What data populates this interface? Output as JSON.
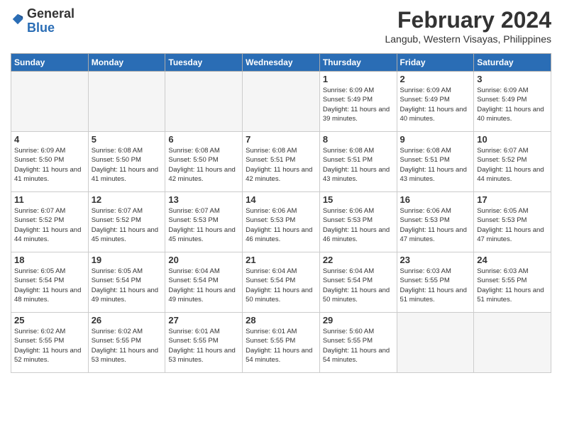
{
  "app": {
    "logo_general": "General",
    "logo_blue": "Blue",
    "title": "February 2024",
    "location": "Langub, Western Visayas, Philippines"
  },
  "calendar": {
    "days_of_week": [
      "Sunday",
      "Monday",
      "Tuesday",
      "Wednesday",
      "Thursday",
      "Friday",
      "Saturday"
    ],
    "weeks": [
      [
        {
          "day": "",
          "info": ""
        },
        {
          "day": "",
          "info": ""
        },
        {
          "day": "",
          "info": ""
        },
        {
          "day": "",
          "info": ""
        },
        {
          "day": "1",
          "info": "Sunrise: 6:09 AM\nSunset: 5:49 PM\nDaylight: 11 hours and 39 minutes."
        },
        {
          "day": "2",
          "info": "Sunrise: 6:09 AM\nSunset: 5:49 PM\nDaylight: 11 hours and 40 minutes."
        },
        {
          "day": "3",
          "info": "Sunrise: 6:09 AM\nSunset: 5:49 PM\nDaylight: 11 hours and 40 minutes."
        }
      ],
      [
        {
          "day": "4",
          "info": "Sunrise: 6:09 AM\nSunset: 5:50 PM\nDaylight: 11 hours and 41 minutes."
        },
        {
          "day": "5",
          "info": "Sunrise: 6:08 AM\nSunset: 5:50 PM\nDaylight: 11 hours and 41 minutes."
        },
        {
          "day": "6",
          "info": "Sunrise: 6:08 AM\nSunset: 5:50 PM\nDaylight: 11 hours and 42 minutes."
        },
        {
          "day": "7",
          "info": "Sunrise: 6:08 AM\nSunset: 5:51 PM\nDaylight: 11 hours and 42 minutes."
        },
        {
          "day": "8",
          "info": "Sunrise: 6:08 AM\nSunset: 5:51 PM\nDaylight: 11 hours and 43 minutes."
        },
        {
          "day": "9",
          "info": "Sunrise: 6:08 AM\nSunset: 5:51 PM\nDaylight: 11 hours and 43 minutes."
        },
        {
          "day": "10",
          "info": "Sunrise: 6:07 AM\nSunset: 5:52 PM\nDaylight: 11 hours and 44 minutes."
        }
      ],
      [
        {
          "day": "11",
          "info": "Sunrise: 6:07 AM\nSunset: 5:52 PM\nDaylight: 11 hours and 44 minutes."
        },
        {
          "day": "12",
          "info": "Sunrise: 6:07 AM\nSunset: 5:52 PM\nDaylight: 11 hours and 45 minutes."
        },
        {
          "day": "13",
          "info": "Sunrise: 6:07 AM\nSunset: 5:53 PM\nDaylight: 11 hours and 45 minutes."
        },
        {
          "day": "14",
          "info": "Sunrise: 6:06 AM\nSunset: 5:53 PM\nDaylight: 11 hours and 46 minutes."
        },
        {
          "day": "15",
          "info": "Sunrise: 6:06 AM\nSunset: 5:53 PM\nDaylight: 11 hours and 46 minutes."
        },
        {
          "day": "16",
          "info": "Sunrise: 6:06 AM\nSunset: 5:53 PM\nDaylight: 11 hours and 47 minutes."
        },
        {
          "day": "17",
          "info": "Sunrise: 6:05 AM\nSunset: 5:53 PM\nDaylight: 11 hours and 47 minutes."
        }
      ],
      [
        {
          "day": "18",
          "info": "Sunrise: 6:05 AM\nSunset: 5:54 PM\nDaylight: 11 hours and 48 minutes."
        },
        {
          "day": "19",
          "info": "Sunrise: 6:05 AM\nSunset: 5:54 PM\nDaylight: 11 hours and 49 minutes."
        },
        {
          "day": "20",
          "info": "Sunrise: 6:04 AM\nSunset: 5:54 PM\nDaylight: 11 hours and 49 minutes."
        },
        {
          "day": "21",
          "info": "Sunrise: 6:04 AM\nSunset: 5:54 PM\nDaylight: 11 hours and 50 minutes."
        },
        {
          "day": "22",
          "info": "Sunrise: 6:04 AM\nSunset: 5:54 PM\nDaylight: 11 hours and 50 minutes."
        },
        {
          "day": "23",
          "info": "Sunrise: 6:03 AM\nSunset: 5:55 PM\nDaylight: 11 hours and 51 minutes."
        },
        {
          "day": "24",
          "info": "Sunrise: 6:03 AM\nSunset: 5:55 PM\nDaylight: 11 hours and 51 minutes."
        }
      ],
      [
        {
          "day": "25",
          "info": "Sunrise: 6:02 AM\nSunset: 5:55 PM\nDaylight: 11 hours and 52 minutes."
        },
        {
          "day": "26",
          "info": "Sunrise: 6:02 AM\nSunset: 5:55 PM\nDaylight: 11 hours and 53 minutes."
        },
        {
          "day": "27",
          "info": "Sunrise: 6:01 AM\nSunset: 5:55 PM\nDaylight: 11 hours and 53 minutes."
        },
        {
          "day": "28",
          "info": "Sunrise: 6:01 AM\nSunset: 5:55 PM\nDaylight: 11 hours and 54 minutes."
        },
        {
          "day": "29",
          "info": "Sunrise: 5:60 AM\nSunset: 5:55 PM\nDaylight: 11 hours and 54 minutes."
        },
        {
          "day": "",
          "info": ""
        },
        {
          "day": "",
          "info": ""
        }
      ]
    ]
  }
}
